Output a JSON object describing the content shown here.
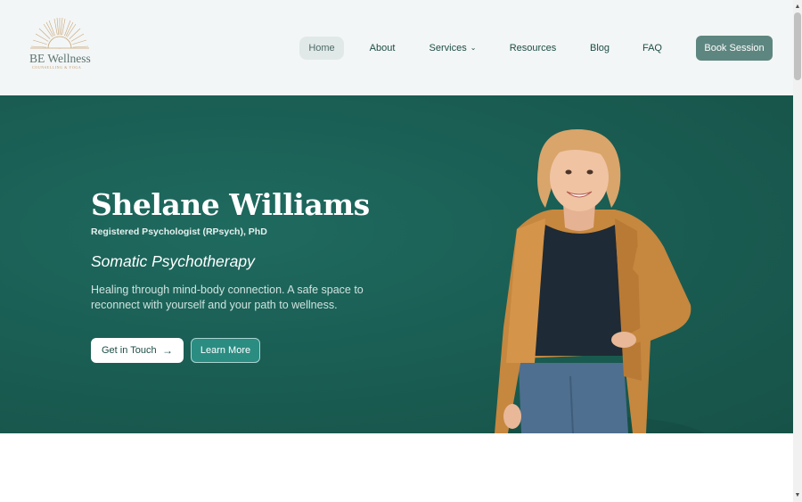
{
  "brand": {
    "name": "BE Wellness",
    "tagline": "COUNSELLING & YOGA",
    "accent_gold": "#c19a6b"
  },
  "nav": {
    "items": [
      {
        "label": "Home",
        "active": true
      },
      {
        "label": "About"
      },
      {
        "label": "Services",
        "icon": "chevron-down-icon"
      },
      {
        "label": "Resources"
      },
      {
        "label": "Blog"
      },
      {
        "label": "FAQ"
      }
    ],
    "cta_label": "Book Session"
  },
  "hero": {
    "name": "Shelane Williams",
    "credentials": "Registered Psychologist (RPsych), PhD",
    "specialty": "Somatic Psychotherapy",
    "description": "Healing through mind-body connection. A safe space to reconnect with yourself and your path to wellness.",
    "primary_button": "Get in Touch",
    "primary_button_icon": "arrow-right-icon",
    "secondary_button": "Learn More",
    "background_color": "#1a5e54"
  },
  "colors": {
    "header_bg": "#f3f6f6",
    "nav_text": "#1d4d45",
    "cta_bg": "#5e8680"
  }
}
